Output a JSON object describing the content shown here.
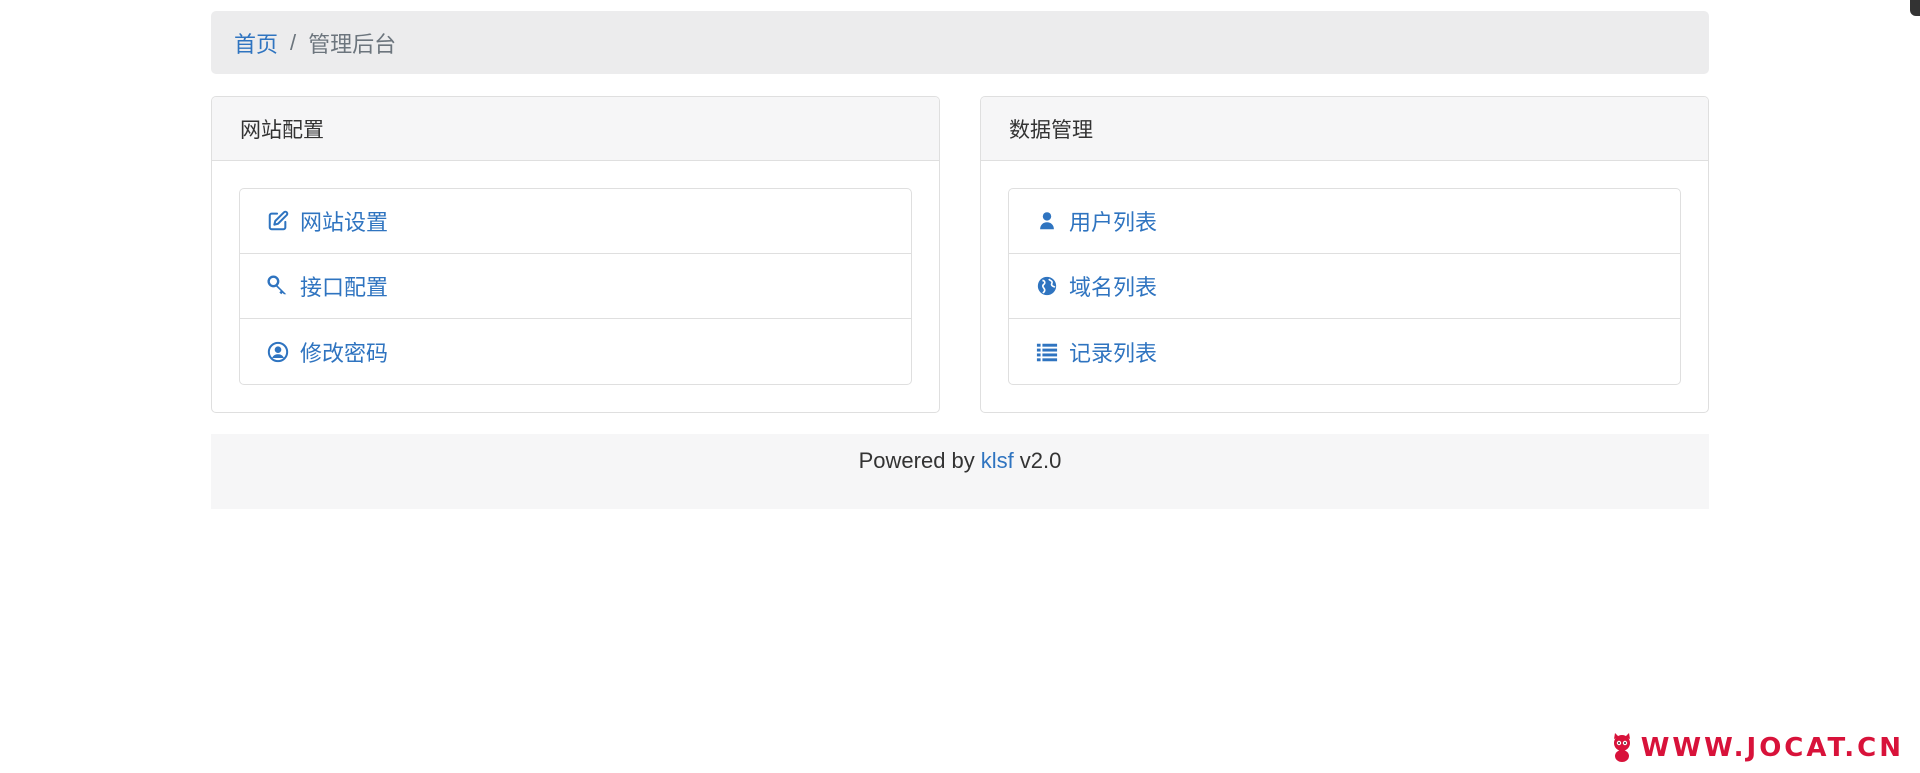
{
  "breadcrumb": {
    "home": "首页",
    "separator": "/",
    "current": "管理后台"
  },
  "panels": [
    {
      "title": "网站配置",
      "items": [
        {
          "label": "网站设置",
          "icon": "edit-icon"
        },
        {
          "label": "接口配置",
          "icon": "key-icon"
        },
        {
          "label": "修改密码",
          "icon": "user-circle-icon"
        }
      ]
    },
    {
      "title": "数据管理",
      "items": [
        {
          "label": "用户列表",
          "icon": "user-icon"
        },
        {
          "label": "域名列表",
          "icon": "globe-icon"
        },
        {
          "label": "记录列表",
          "icon": "list-icon"
        }
      ]
    }
  ],
  "footer": {
    "prefix": "Powered by",
    "link": "klsf",
    "version": "v2.0"
  },
  "watermark": {
    "text": "WWW.JOCAT.CN"
  },
  "colors": {
    "link": "#2f74c0",
    "breadcrumb_bg": "#ececed",
    "panel_header_bg": "#f6f6f7",
    "border": "#dfdfdf",
    "watermark": "#d8123a"
  }
}
